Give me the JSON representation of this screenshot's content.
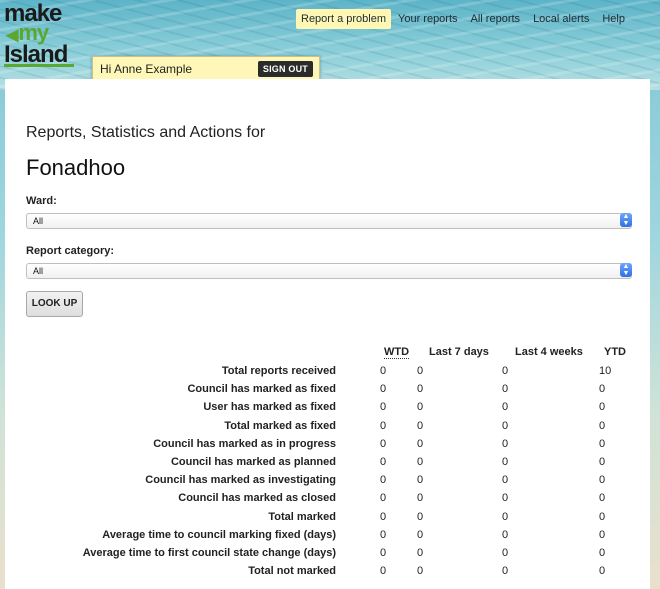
{
  "logo": {
    "line1": "make",
    "line2": "my",
    "line3": "Island"
  },
  "nav": {
    "items": [
      {
        "label": "Report a problem",
        "active": true
      },
      {
        "label": "Your reports"
      },
      {
        "label": "All reports"
      },
      {
        "label": "Local alerts"
      },
      {
        "label": "Help"
      }
    ]
  },
  "user": {
    "greeting": "Hi Anne Example",
    "sign_out": "SIGN OUT"
  },
  "page": {
    "subtitle": "Reports, Statistics and Actions for",
    "place": "Fonadhoo",
    "ward_label": "Ward:",
    "ward_value": "All",
    "category_label": "Report category:",
    "category_value": "All",
    "lookup": "LOOK UP"
  },
  "stats": {
    "columns": [
      "WTD",
      "Last 7 days",
      "Last 4 weeks",
      "YTD"
    ],
    "rows": [
      {
        "label": "Total reports received",
        "values": [
          "0",
          "0",
          "0",
          "10"
        ]
      },
      {
        "label": "Council has marked as fixed",
        "values": [
          "0",
          "0",
          "0",
          "0"
        ]
      },
      {
        "label": "User has marked as fixed",
        "values": [
          "0",
          "0",
          "0",
          "0"
        ]
      },
      {
        "label": "Total marked as fixed",
        "values": [
          "0",
          "0",
          "0",
          "0"
        ]
      },
      {
        "label": "Council has marked as in progress",
        "values": [
          "0",
          "0",
          "0",
          "0"
        ]
      },
      {
        "label": "Council has marked as planned",
        "values": [
          "0",
          "0",
          "0",
          "0"
        ]
      },
      {
        "label": "Council has marked as investigating",
        "values": [
          "0",
          "0",
          "0",
          "0"
        ]
      },
      {
        "label": "Council has marked as closed",
        "values": [
          "0",
          "0",
          "0",
          "0"
        ]
      },
      {
        "label": "Total marked",
        "values": [
          "0",
          "0",
          "0",
          "0"
        ]
      },
      {
        "label": "Average time to council marking fixed (days)",
        "values": [
          "0",
          "0",
          "0",
          "0"
        ]
      },
      {
        "label": "Average time to first council state change (days)",
        "values": [
          "0",
          "0",
          "0",
          "0"
        ]
      },
      {
        "label": "Total not marked",
        "values": [
          "0",
          "0",
          "0",
          "0"
        ]
      }
    ]
  },
  "colors": {
    "accent": "#5aa832",
    "highlight": "#fff7b8",
    "select_arrow": "#2f6fe0"
  }
}
